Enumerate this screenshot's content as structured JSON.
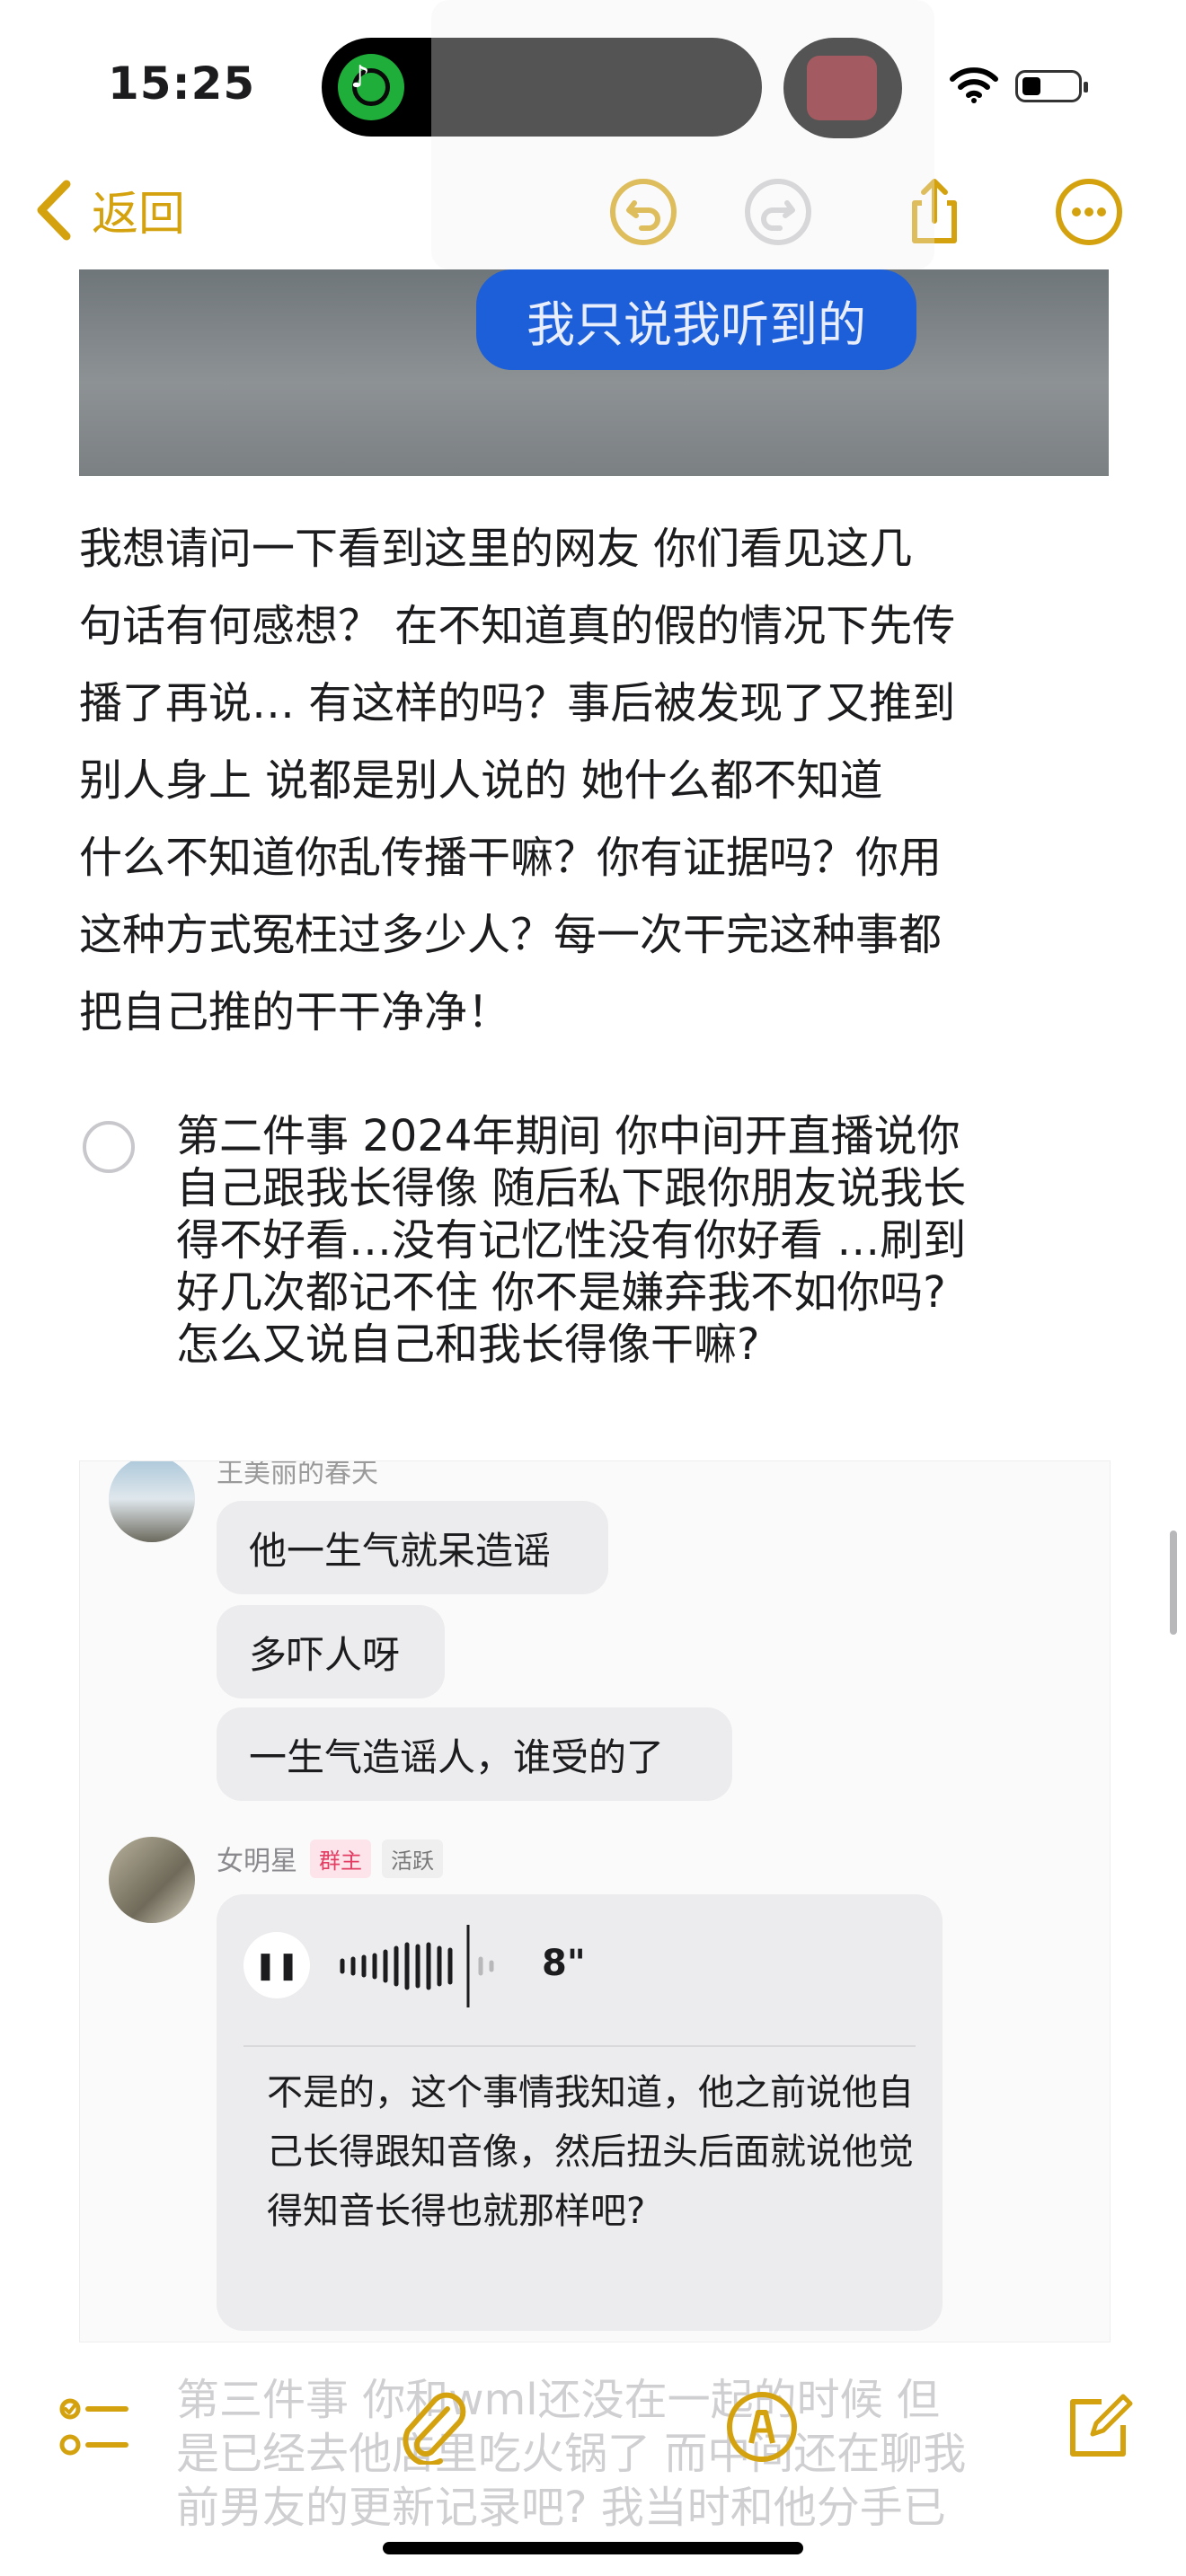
{
  "status_bar": {
    "time": "15:25"
  },
  "nav": {
    "back_label": "返回"
  },
  "screenshot_bubble": "我只说我听到的",
  "paragraph": [
    " 我想请问一下看到这里的网友 你们看见这几",
    "句话有何感想？ 在不知道真的假的情况下先传",
    "播了再说… 有这样的吗？事后被发现了又推到",
    "别人身上 说都是别人说的 她什么都不知道",
    "什么不知道你乱传播干嘛？你有证据吗？你用",
    "这种方式冤枉过多少人？每一次干完这种事都",
    "把自己推的干干净净！"
  ],
  "checklist_item": [
    "第二件事 2024年期间 你中间开直播说你",
    "自己跟我长得像 随后私下跟你朋友说我长",
    "得不好看…没有记忆性没有你好看 …刷到",
    "好几次都记不住 你不是嫌弃我不如你吗?",
    "怎么又说自己和我长得像干嘛?"
  ],
  "chat": {
    "user1_name": "王美丽的春天",
    "messages": [
      "他一生气就呆造谣",
      "多吓人呀",
      "一生气造谣人，谁受的了"
    ],
    "user2_name": "女明星",
    "badge_host": "群主",
    "badge_active": "活跃",
    "voice_duration": "8\"",
    "voice_transcript": "不是的，这个事情我知道，他之前说他自己长得跟知音像，然后扭头后面就说他觉得知音长得也就那样吧?"
  },
  "faded_text": [
    "第三件事 你和wml还没在一起的时候 但",
    "是已经去他店里吃火锅了 而中间还在聊我",
    "前男友的更新记录吧? 我当时和他分手已"
  ],
  "colors": {
    "accent": "#d4a20e",
    "chat_bubble": "#ececee",
    "screenshot_bubble": "#1d5fd8"
  }
}
